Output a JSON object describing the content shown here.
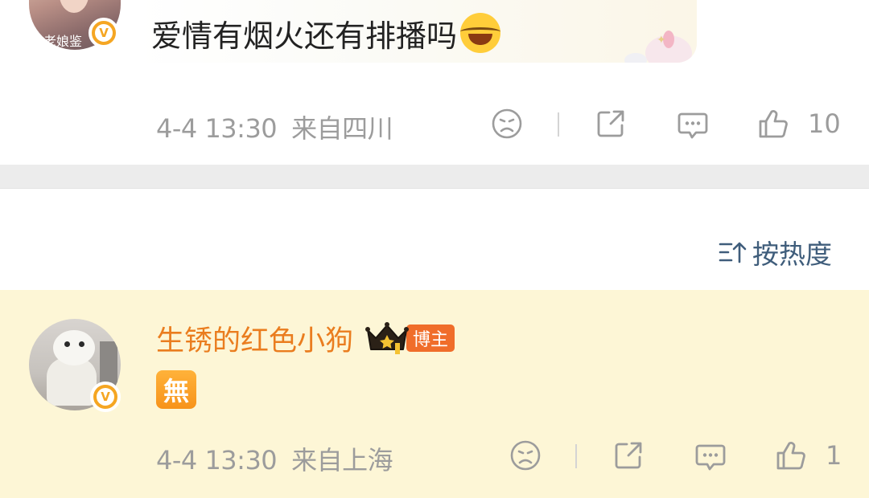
{
  "post": {
    "avatar_tag": "老娘鉴",
    "verified_badge": "V",
    "text": "爱情有烟火还有排播吗",
    "emoji": "laughing-tears-emoji",
    "time": "4-4 13:30",
    "location": "来自四川",
    "like_count": "10"
  },
  "sort": {
    "label": "按热度",
    "icon": "sort-icon"
  },
  "comment": {
    "author": "生锈的红色小狗",
    "host_badge": "博主",
    "verified_badge": "V",
    "content": "無",
    "time": "4-4 13:30",
    "location": "来自上海",
    "like_count": "1"
  },
  "colors": {
    "author_name": "#ea7d1f",
    "host_badge_bg": "#f06d2a",
    "verified": "#f5a623",
    "meta_text": "#9c9c9c",
    "highlight_bg": "#fdf6d6",
    "sort_text": "#3f5d7b"
  }
}
